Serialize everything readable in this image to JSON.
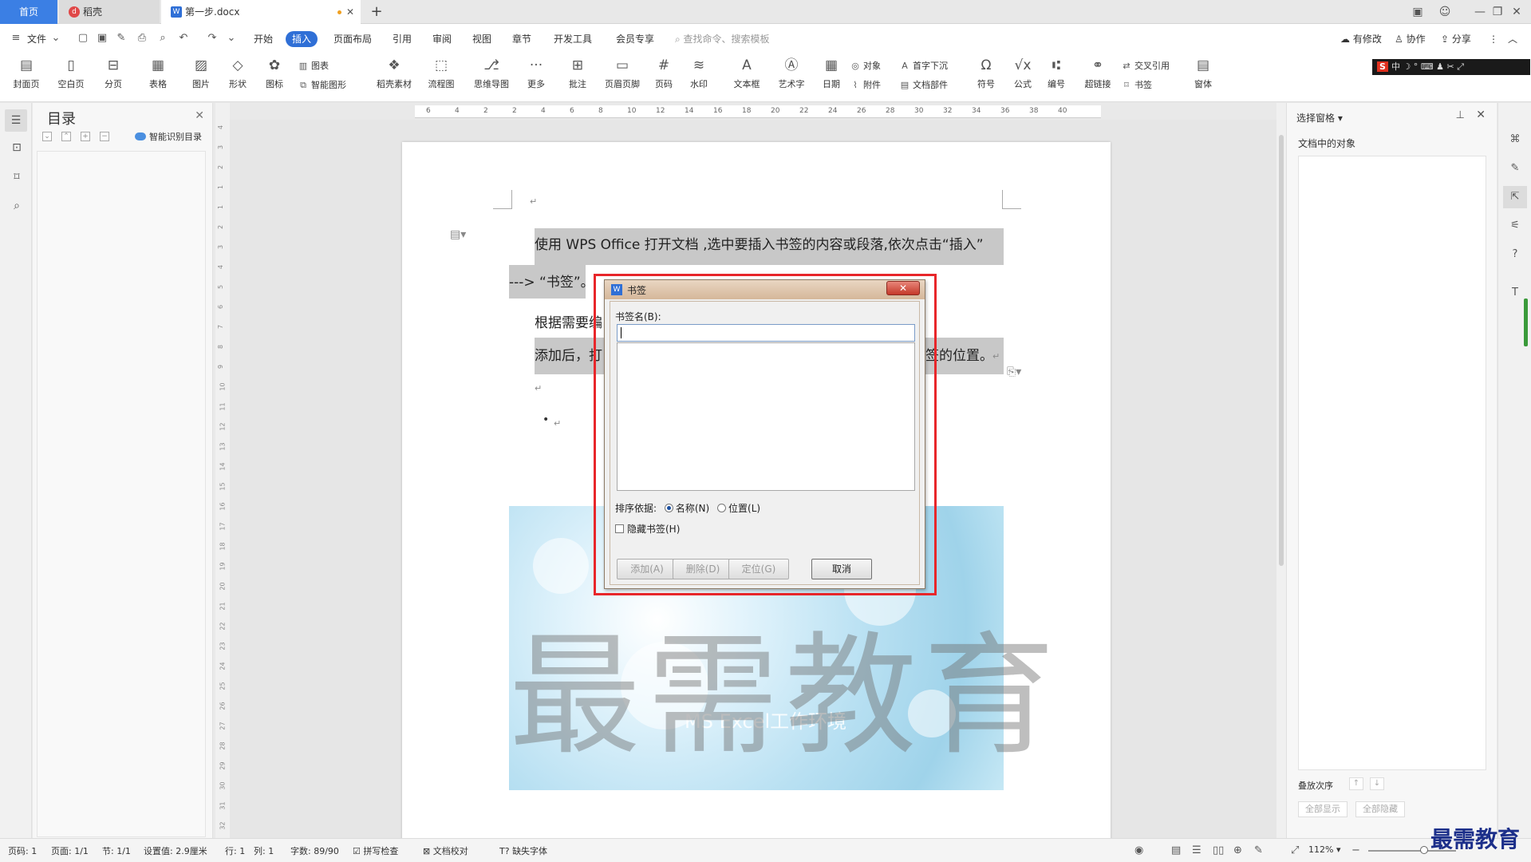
{
  "tabs": [
    {
      "label": "首页"
    },
    {
      "label": "稻壳",
      "icon": "daoke-icon"
    },
    {
      "label": "第一步.docx",
      "icon": "wps-writer-icon"
    }
  ],
  "menu": {
    "file": "文件",
    "items": [
      "开始",
      "插入",
      "页面布局",
      "引用",
      "审阅",
      "视图",
      "章节",
      "开发工具",
      "会员专享"
    ],
    "active": "插入",
    "search_placeholder": "查找命令、搜索模板",
    "right": [
      "有修改",
      "协作",
      "分享"
    ]
  },
  "ribbon": {
    "big": [
      "封面页",
      "空白页",
      "分页",
      "表格",
      "图片",
      "形状",
      "图标",
      "稻壳素材",
      "流程图",
      "思维导图",
      "更多",
      "批注",
      "页眉页脚",
      "页码",
      "水印",
      "文本框",
      "艺术字",
      "日期",
      "符号",
      "公式",
      "编号",
      "超链接",
      "窗体"
    ],
    "small": {
      "chart": "图表",
      "smart_shape": "智能图形",
      "object": "对象",
      "attachment": "附件",
      "dropcap": "首字下沉",
      "doc_parts": "文档部件",
      "cross_ref": "交叉引用",
      "bookmark": "书签"
    },
    "ime_text": "中"
  },
  "toc": {
    "title": "目录",
    "smart_label": "智能识别目录"
  },
  "ruler_h": [
    "6",
    "4",
    "2",
    "2",
    "4",
    "6",
    "8",
    "10",
    "12",
    "14",
    "16",
    "18",
    "20",
    "22",
    "24",
    "26",
    "28",
    "30",
    "32",
    "34",
    "36",
    "38",
    "40"
  ],
  "ruler_v": [
    "4",
    "3",
    "2",
    "1",
    "1",
    "2",
    "3",
    "4",
    "5",
    "6",
    "7",
    "8",
    "9",
    "10",
    "11",
    "12",
    "13",
    "14",
    "15",
    "16",
    "17",
    "18",
    "19",
    "20",
    "21",
    "22",
    "23",
    "24",
    "25",
    "26",
    "27",
    "28",
    "29",
    "30",
    "31",
    "32"
  ],
  "document": {
    "line1": "使用 WPS Office 打开文档 ,选中要插入书签的内容或段落,依次点击“插入”",
    "line2a": "--->  “书签”",
    "line2b": "。",
    "line3": "根据需要编",
    "line4a": "添加后，打",
    "line4b": "签的位置。",
    "image_caption": "MS Excel工作环境",
    "watermark": "最需教育"
  },
  "dialog": {
    "title": "书签",
    "name_label": "书签名(B):",
    "name_value": "",
    "sort_label": "排序依据:",
    "sort_options": [
      "名称(N)",
      "位置(L)"
    ],
    "sort_selected": "名称(N)",
    "hidden_label": "隐藏书签(H)",
    "hidden_checked": false,
    "buttons": {
      "add": "添加(A)",
      "delete": "删除(D)",
      "locate": "定位(G)",
      "cancel": "取消"
    }
  },
  "right_panel": {
    "title": "选择窗格",
    "subtitle": "文档中的对象",
    "order_label": "叠放次序",
    "show_all": "全部显示",
    "hide_all": "全部隐藏"
  },
  "status": {
    "page": "页码: 1",
    "pages": "页面: 1/1",
    "section": "节: 1/1",
    "setting": "设置值: 2.9厘米",
    "row": "行: 1",
    "col": "列: 1",
    "words": "字数: 89/90",
    "spell": "拼写检查",
    "doc_check": "文档校对",
    "missing_font": "缺失字体",
    "zoom": "112%"
  },
  "brand_logo": "最需教育",
  "colors": {
    "accent": "#2f6fd6",
    "highlight_frame": "#e8262a",
    "selection": "#c8c8c8"
  }
}
